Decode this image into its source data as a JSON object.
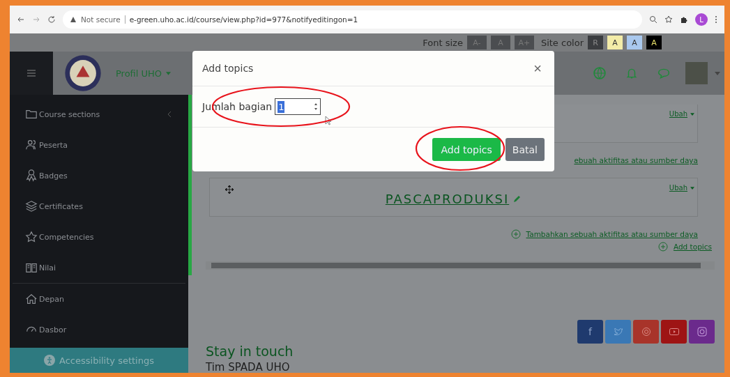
{
  "browser": {
    "security": "Not secure",
    "url": "e-green.uho.ac.id/course/view.php?id=977&notifyeditingon=1",
    "profile_initial": "L"
  },
  "accessibility_toolbar": {
    "font_size_label": "Font size",
    "font_buttons": [
      "A-",
      "A",
      "A+"
    ],
    "site_color_label": "Site color",
    "color_buttons": [
      {
        "label": "R",
        "color": "#3b3d40"
      },
      {
        "label": "A",
        "color": "#f3eca8"
      },
      {
        "label": "A",
        "color": "#a9c8ee"
      },
      {
        "label": "A",
        "color": "#000000"
      }
    ]
  },
  "header": {
    "site_menu": "Profil UHO"
  },
  "sidebar": {
    "items": [
      {
        "kind": "folder",
        "label": "Course sections",
        "expandable": true
      },
      {
        "kind": "users",
        "label": "Peserta",
        "expandable": false
      },
      {
        "kind": "badge",
        "label": "Badges",
        "expandable": false
      },
      {
        "kind": "layers",
        "label": "Certificates",
        "expandable": false
      },
      {
        "kind": "star",
        "label": "Competencies",
        "expandable": false
      },
      {
        "kind": "book",
        "label": "Nilai",
        "expandable": false
      },
      {
        "kind": "home",
        "label": "Depan",
        "expandable": false
      },
      {
        "kind": "gauge",
        "label": "Dasbor",
        "expandable": false
      }
    ],
    "accessibility_settings": "Accessibility settings"
  },
  "sections": [
    {
      "edit_menu": "Ubah",
      "add_activity": "ebuah aktifitas atau sumber daya"
    },
    {
      "title": "PASCAPRODUKSI",
      "edit_menu": "Ubah",
      "add_activity": "Tambahkan sebuah aktifitas atau sumber daya"
    }
  ],
  "add_topics_link": "Add topics",
  "footer": {
    "heading": "Stay in touch",
    "team": "Tim SPADA UHO",
    "social": [
      {
        "kind": "facebook",
        "label": "f",
        "color": "#1f3a6e"
      },
      {
        "kind": "twitter",
        "color": "#3a78b5"
      },
      {
        "kind": "web",
        "color": "#a8342a"
      },
      {
        "kind": "youtube",
        "color": "#9e1414"
      },
      {
        "kind": "instagram",
        "color": "#6b2a8c"
      }
    ]
  },
  "modal": {
    "title": "Add topics",
    "close": "×",
    "field_label": "Jumlah bagian",
    "field_value": "1",
    "primary_button": "Add topics",
    "secondary_button": "Batal"
  }
}
